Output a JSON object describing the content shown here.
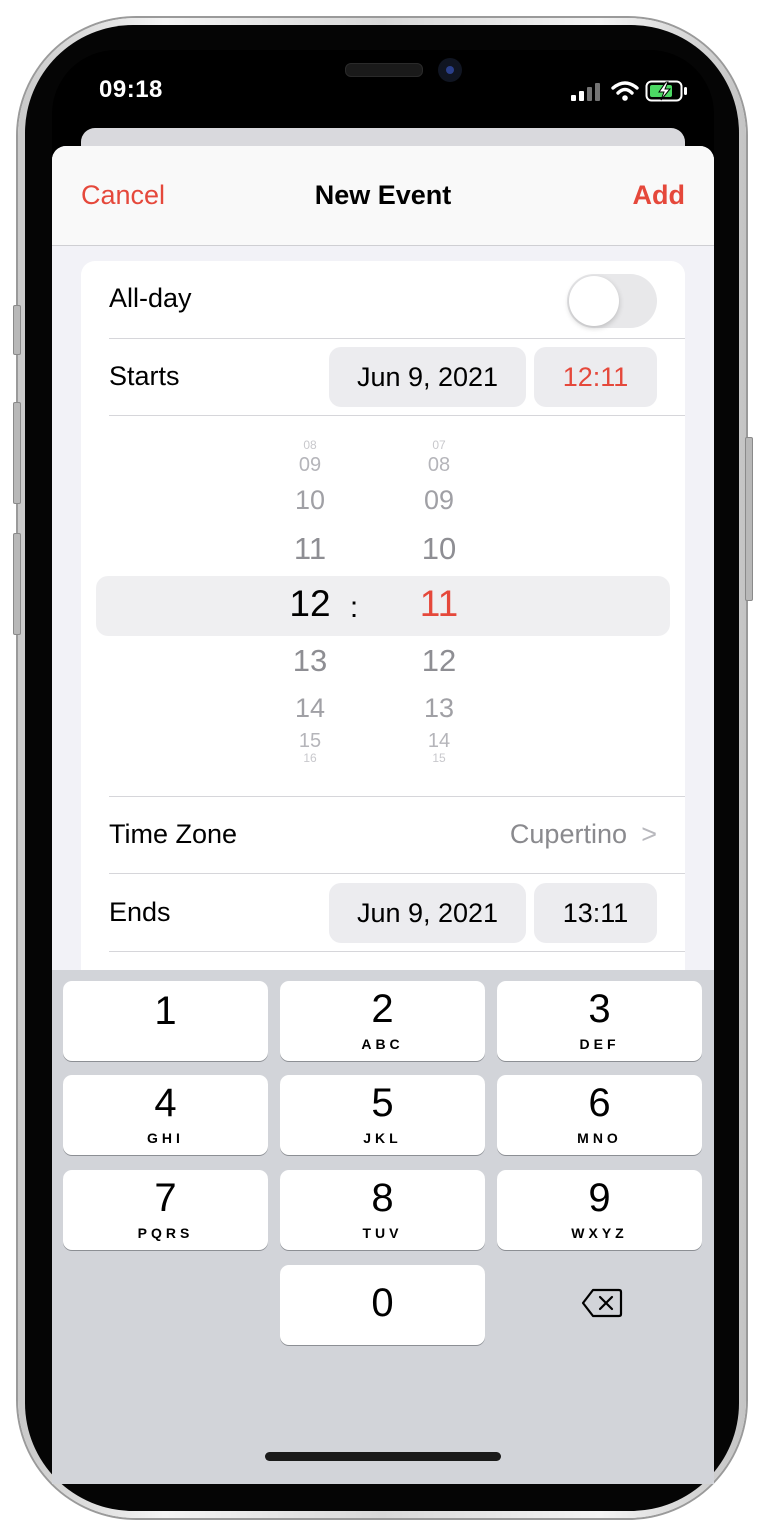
{
  "status_bar": {
    "time": "09:18"
  },
  "nav": {
    "cancel": "Cancel",
    "title": "New Event",
    "add": "Add"
  },
  "all_day": {
    "label": "All-day",
    "on": false
  },
  "starts": {
    "label": "Starts",
    "date": "Jun 9, 2021",
    "time": "12:11"
  },
  "picker": {
    "hours_above": [
      "08",
      "09",
      "10",
      "11"
    ],
    "hour_selected": "12",
    "hours_below": [
      "13",
      "14",
      "15",
      "16"
    ],
    "separator": ":",
    "minutes_above": [
      "07",
      "08",
      "09",
      "10"
    ],
    "minute_selected": "11",
    "minutes_below": [
      "12",
      "13",
      "14",
      "15"
    ]
  },
  "time_zone": {
    "label": "Time Zone",
    "value": "Cupertino",
    "chevron": ">"
  },
  "ends": {
    "label": "Ends",
    "date": "Jun 9, 2021",
    "time": "13:11"
  },
  "keypad": {
    "keys": [
      {
        "digit": "1",
        "letters": ""
      },
      {
        "digit": "2",
        "letters": "ABC"
      },
      {
        "digit": "3",
        "letters": "DEF"
      },
      {
        "digit": "4",
        "letters": "GHI"
      },
      {
        "digit": "5",
        "letters": "JKL"
      },
      {
        "digit": "6",
        "letters": "MNO"
      },
      {
        "digit": "7",
        "letters": "PQRS"
      },
      {
        "digit": "8",
        "letters": "TUV"
      },
      {
        "digit": "9",
        "letters": "WXYZ"
      },
      {
        "digit": "0",
        "letters": ""
      }
    ]
  },
  "colors": {
    "accent": "#e5483b",
    "secondary_text": "#8a8a8e",
    "keypad_bg": "#d2d4d9"
  }
}
